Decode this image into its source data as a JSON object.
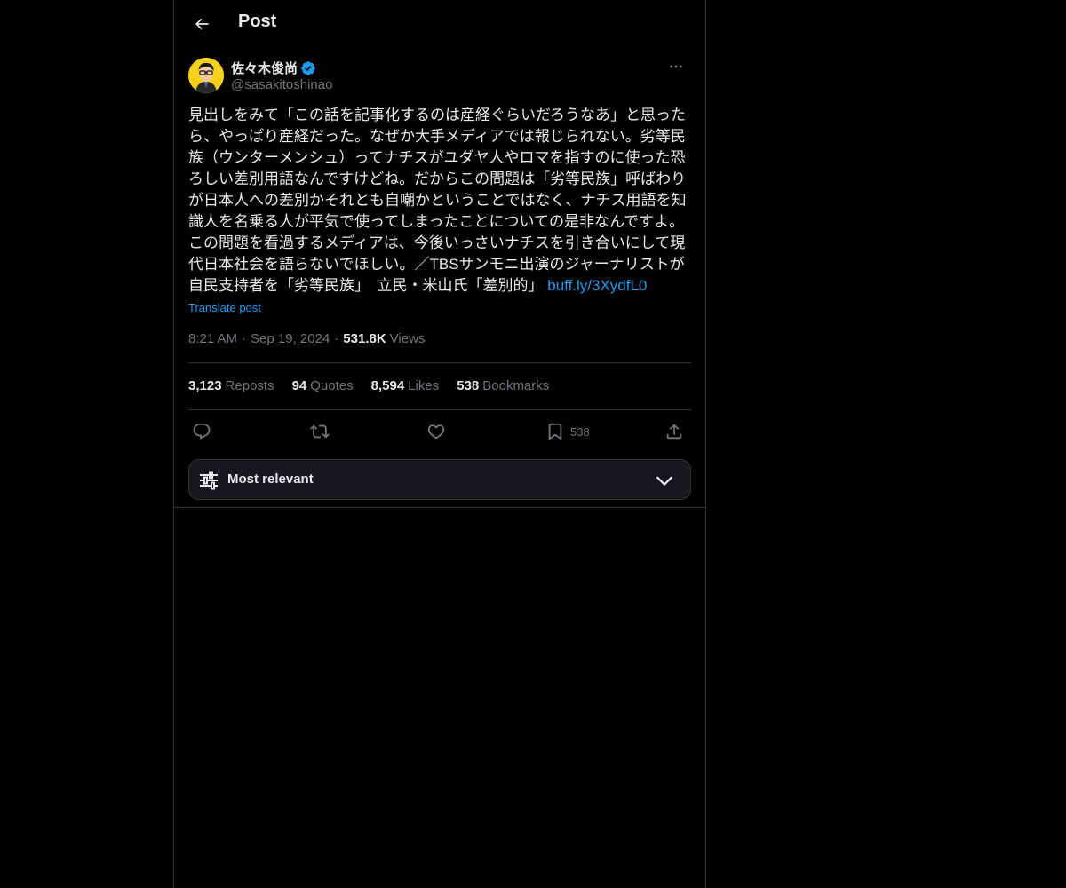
{
  "header": {
    "title": "Post",
    "back_icon": "arrow-left-icon"
  },
  "author": {
    "display_name": "佐々木俊尚",
    "handle": "@sasakitoshinao",
    "verified": true,
    "verified_color": "#1d9bf0"
  },
  "tweet": {
    "text": "見出しをみて「この話を記事化するのは産経ぐらいだろうなあ」と思ったら、やっぱり産経だった。なぜか大手メディアでは報じられない。劣等民族（ウンターメンシュ）ってナチスがユダヤ人やロマを指すのに使った恐ろしい差別用語なんですけどね。だからこの問題は「劣等民族」呼ばわりが日本人への差別かそれとも自嘲かということではなく、ナチス用語を知識人を名乗る人が平気で使ってしまったことについての是非なんですよ。この問題を看過するメディアは、今後いっさいナチスを引き合いにして現代日本社会を語らないでほしい。／TBSサンモニ出演のジャーナリストが自民支持者を「劣等民族」　立民・米山氏「差別的」 ",
    "link": "buff.ly/3XydfL0",
    "translate_label": "Translate post"
  },
  "meta": {
    "time": "8:21 AM",
    "date": "Sep 19, 2024",
    "views_count": "531.8K",
    "views_label": "Views",
    "separator": "·"
  },
  "stats": {
    "reposts_count": "3,123",
    "reposts_label": "Reposts",
    "quotes_count": "94",
    "quotes_label": "Quotes",
    "likes_count": "8,594",
    "likes_label": "Likes",
    "bookmarks_count": "538",
    "bookmarks_label": "Bookmarks"
  },
  "actions": {
    "reply_icon": "reply-icon",
    "repost_icon": "repost-icon",
    "like_icon": "heart-icon",
    "bookmark_icon": "bookmark-icon",
    "bookmark_count": "538",
    "share_icon": "share-icon"
  },
  "sort": {
    "label": "Most relevant",
    "icon": "sliders-icon",
    "chevron": "chevron-down-icon"
  },
  "colors": {
    "background": "#000000",
    "text_primary": "#e7e9ea",
    "text_secondary": "#71767b",
    "accent": "#1d9bf0",
    "border": "#2f3336"
  }
}
